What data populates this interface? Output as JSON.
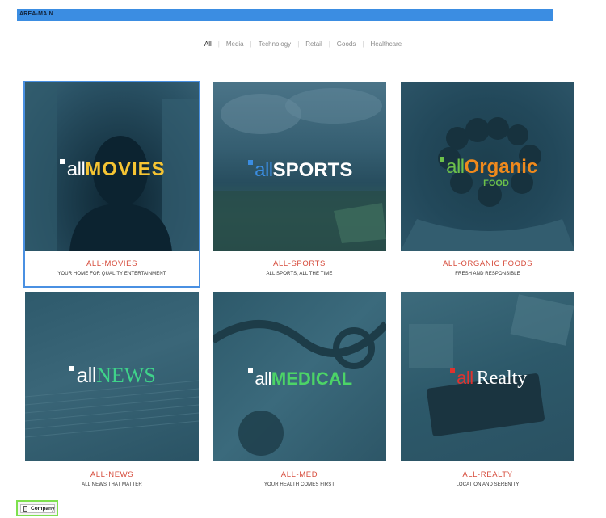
{
  "area_label": "AREA-MAIN",
  "filters": [
    "All",
    "Media",
    "Technology",
    "Retail",
    "Goods",
    "Healthcare"
  ],
  "cards": [
    {
      "logo_all": "all",
      "logo_word": "MOVIES",
      "title": "ALL-MOVIES",
      "subtitle": "YOUR HOME FOR QUALITY ENTERTAINMENT"
    },
    {
      "logo_all": "all",
      "logo_word": "SPORTS",
      "title": "ALL-SPORTS",
      "subtitle": "ALL SPORTS, ALL THE TIME"
    },
    {
      "logo_all": "all",
      "logo_word": "Organic",
      "logo_word2": "FOOD",
      "title": "ALL-ORGANIC FOODS",
      "subtitle": "FRESH AND RESPONSIBLE"
    },
    {
      "logo_all": "all",
      "logo_word": "NEWS",
      "title": "ALL-NEWS",
      "subtitle": "ALL NEWS THAT MATTER"
    },
    {
      "logo_all": "all",
      "logo_word": "MEDICAL",
      "title": "ALL-MED",
      "subtitle": "YOUR HEALTH COMES FIRST"
    },
    {
      "logo_all": "all",
      "logo_word": "Realty",
      "title": "ALL-REALTY",
      "subtitle": "LOCATION AND SERENITY"
    }
  ],
  "company_button": "Company",
  "colors": {
    "accent_red": "#d64b3b",
    "overlay_teal": "#1c4a5e",
    "selected_border": "#4a90e2",
    "area_bar": "#3b8de2",
    "movies_gold": "#f5c433",
    "sports_blue": "#3b8de2",
    "organic_green": "#6cc04a",
    "organic_orange": "#f08a1c",
    "medical_green": "#4cd467",
    "news_green": "#3fd38a",
    "realty_red": "#e0322e"
  }
}
